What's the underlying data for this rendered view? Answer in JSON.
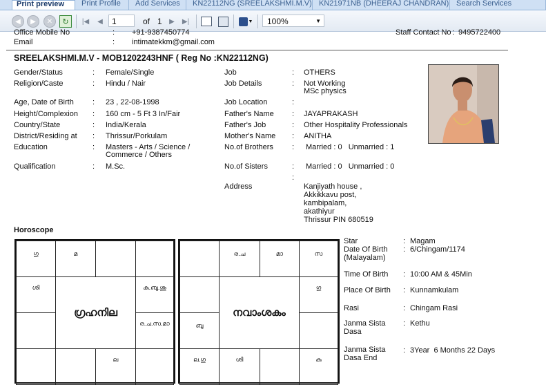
{
  "tabs": [
    {
      "label": "Print preview",
      "active": true
    },
    {
      "label": "Print Profile",
      "active": false
    },
    {
      "label": "Add Services",
      "active": false
    },
    {
      "label": "KN22112NG (SREELAKSHMI.M.V)",
      "active": false
    },
    {
      "label": "KN21971NB (DHEERAJ CHANDRAN)",
      "active": false
    },
    {
      "label": "Search Services",
      "active": false
    }
  ],
  "toolbar": {
    "page_current": "1",
    "of_label": "of",
    "page_total": "1",
    "zoom": "100%",
    "icons": [
      "back-icon",
      "forward-icon",
      "stop-icon",
      "refresh-icon",
      "first-page-icon",
      "prev-page-icon",
      "next-page-icon",
      "last-page-icon",
      "print-layout-icon",
      "page-setup-icon",
      "export-icon",
      "export-dropdown-icon",
      "zoom-dropdown-icon"
    ]
  },
  "contact": {
    "office_label": "Office Mobile No",
    "office_value": "+91-9387450774",
    "email_label": "Email",
    "email_value": "intimatekkm@gmail.com",
    "staff_label": "Staff Contact No",
    "staff_value": "9495722400"
  },
  "profile": {
    "heading": "SREELAKSHMI.M.V - MOB1202243HNF ( Reg No :KN22112NG)",
    "left": [
      {
        "label": "Gender/Status",
        "value": "Female/Single"
      },
      {
        "label": "Religion/Caste",
        "value": "Hindu / Nair"
      },
      {
        "label": "Age, Date of Birth",
        "value": "23 , 22-08-1998"
      },
      {
        "label": "Height/Complexion",
        "value": "160 cm - 5 Ft 3 In/Fair"
      },
      {
        "label": "Country/State",
        "value": "India/Kerala"
      },
      {
        "label": "District/Residing at",
        "value": "Thrissur/Porkulam"
      },
      {
        "label": "Education",
        "value": "Masters - Arts / Science /",
        "value2": "Commerce / Others"
      },
      {
        "label": "Qualification",
        "value": "M.Sc."
      }
    ],
    "right": [
      {
        "label": "Job",
        "value": "OTHERS"
      },
      {
        "label": "Job Details",
        "value": "Not Working",
        "value2": "MSc physics"
      },
      {
        "label": "Job Location",
        "value": ""
      },
      {
        "label": "Father's Name",
        "value": "JAYAPRAKASH"
      },
      {
        "label": "Father's Job",
        "value": "Other Hospitality Professionals"
      },
      {
        "label": "Mother's Name",
        "value": "ANITHA"
      },
      {
        "label": "No.of Brothers",
        "value": "Married : 0   Unmarried : 1"
      },
      {
        "label": "No.of Sisters",
        "value": "Married : 0   Unmarried : 0"
      }
    ],
    "address_label": "Address",
    "address_lines": [
      "Kanjiyath house ,",
      "Akkikkavu post,",
      "kambipalam,",
      "akathiyur",
      "Thrissur PIN 680519"
    ],
    "separator": ":"
  },
  "horoscope": {
    "label": "Horoscope",
    "chart1_title": "ഗ്രഹനില",
    "chart1_cells": [
      "ഗു",
      "മ",
      "",
      "",
      "ശി",
      "കു.ബു.ശു",
      "",
      "ര.ച.സ.മാ",
      "",
      "",
      "ല",
      ""
    ],
    "chart2_title": "നവാംശകം",
    "chart2_cells": [
      "",
      "ര.ച",
      "മാ",
      "സ",
      "",
      "ഗു",
      "ബു",
      "",
      "ല.ഗു",
      "ശി",
      "",
      "കു"
    ],
    "details": [
      {
        "label": "Star",
        "value": "Magam"
      },
      {
        "label": "Date Of Birth",
        "label2": "(Malayalam)",
        "value": "6/Chingam/1174"
      },
      {
        "label": "Time Of Birth",
        "value": "10:00 AM & 45Min"
      },
      {
        "label": "Place Of Birth",
        "value": "Kunnamkulam"
      },
      {
        "label": "Rasi",
        "value": "Chingam Rasi"
      },
      {
        "label": "Janma Sista",
        "label2": "Dasa",
        "value": "Kethu"
      },
      {
        "label": "Janma Sista",
        "label2": "Dasa End",
        "value": "3Year  6 Months 22 Days"
      }
    ]
  },
  "colors": {
    "tab_bg": "#cfe0f4",
    "toolbar_bg": "#e3eaf3",
    "accent": "#1a3a6a"
  }
}
